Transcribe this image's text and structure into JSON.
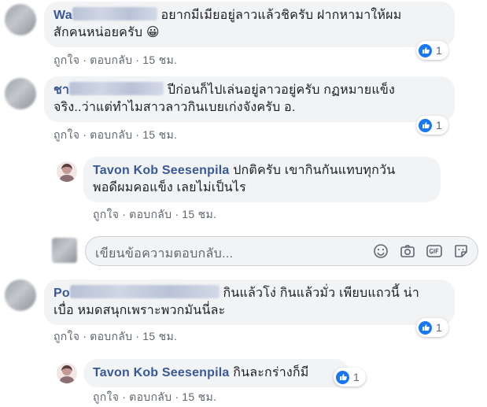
{
  "comments": [
    {
      "author_visible": "Wa",
      "author_tail": "",
      "text_line1": "อยากมีเมียอยู่ลาวแล้วชิครับ ฝากหามาให้ผม",
      "text_line2": "สักคนหน่อยครับ",
      "emoji": "😀",
      "like_label": "ถูกใจ",
      "reply_label": "ตอบกลับ",
      "time": "15 ชม.",
      "reaction_count": "1"
    },
    {
      "author_visible": "ชา",
      "text_line1": "ปีก่อนก็ไปเล่นอยู่ลาวอยู่ครับ กฏหมายแข็ง",
      "text_line2": "จริง..ว่าแต่ทำไมสาวลาวกินเบยเก่งจังครับ อ.",
      "like_label": "ถูกใจ",
      "reply_label": "ตอบกลับ",
      "time": "15 ชม.",
      "reaction_count": "1"
    },
    {
      "author_visible": "Po",
      "text_line1": "กินแล้วโง่ กินแล้วมั่ว เพียบแถวนี้ น่า",
      "text_line2": "เบื่อ หมดสนุกเพราะพวกมันนี่ละ",
      "like_label": "ถูกใจ",
      "reply_label": "ตอบกลับ",
      "time": "15 ชม.",
      "reaction_count": "1"
    }
  ],
  "replies": [
    {
      "author": "Tavon Kob Seesenpila",
      "text_line1": "ปกติครับ เขากินกันแทบทุกวัน",
      "text_line2": "พอดีผมคอแข็ง เลยไม่เป็นไร",
      "like_label": "ถูกใจ",
      "reply_label": "ตอบกลับ",
      "time": "15 ชม."
    },
    {
      "author": "Tavon Kob Seesenpila",
      "text_line1": "กินละกร่างก็มี",
      "like_label": "ถูกใจ",
      "reply_label": "ตอบกลับ",
      "time": "15 ชม.",
      "reaction_count": "1"
    }
  ],
  "reply_input": {
    "placeholder": "เขียนข้อความตอบกลับ..."
  },
  "icons": {
    "like": "like-icon",
    "emoji": "smiley-icon",
    "camera": "camera-icon",
    "gif": "gif-icon",
    "sticker": "sticker-icon"
  },
  "colors": {
    "author": "#385898",
    "bubble": "#f2f3f5",
    "like_blue": "#1877f2",
    "meta": "#606770"
  }
}
